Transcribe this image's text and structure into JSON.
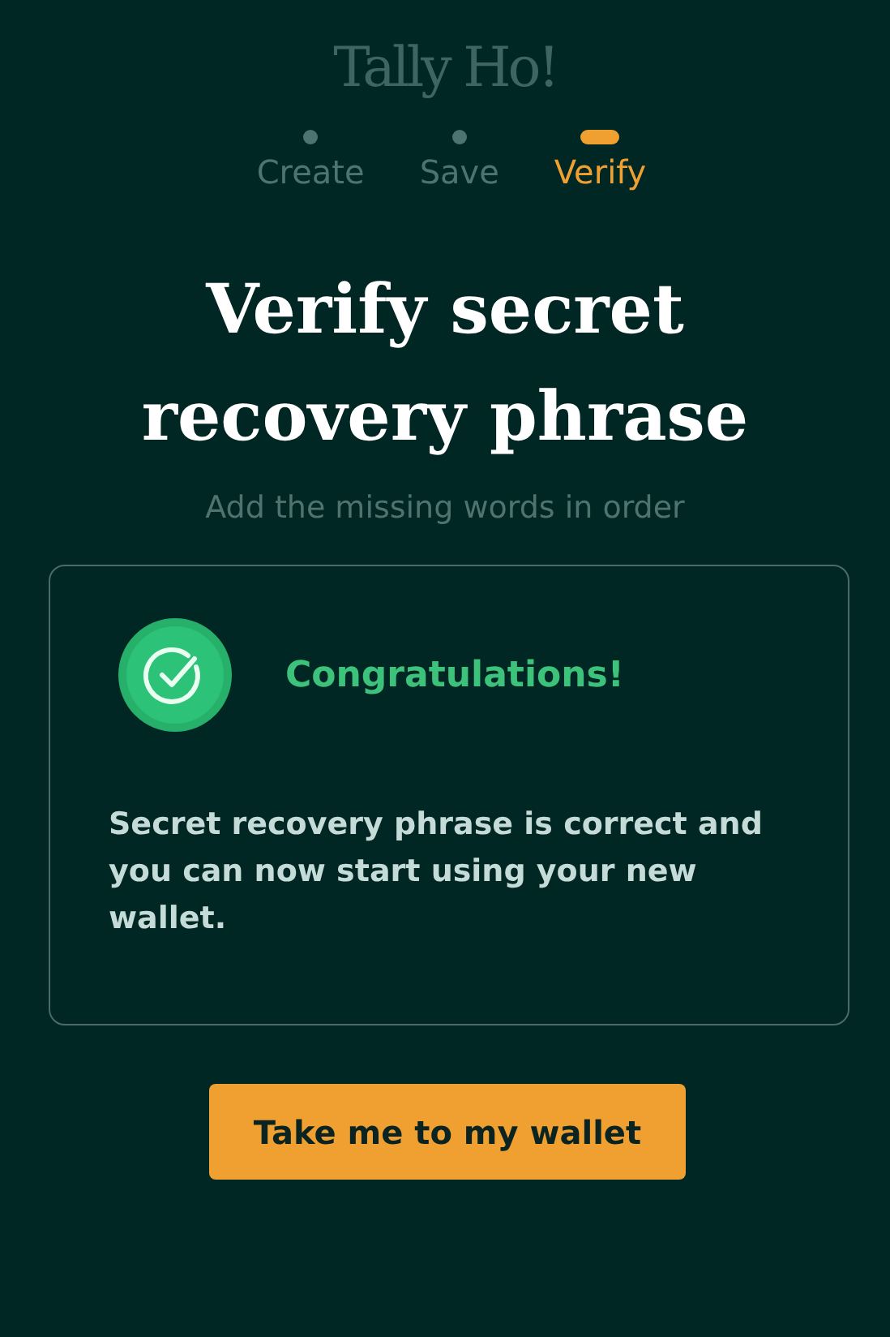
{
  "logo": "Tally Ho!",
  "steps": [
    {
      "label": "Create",
      "selected": false
    },
    {
      "label": "Save",
      "selected": false
    },
    {
      "label": "Verify",
      "selected": true
    }
  ],
  "title": "Verify secret recovery phrase",
  "subtitle": "Add the missing words in order",
  "card": {
    "heading": "Congratulations!",
    "message": "Secret recovery phrase is correct and you can now start using your new wallet."
  },
  "button": "Take me to my wallet"
}
